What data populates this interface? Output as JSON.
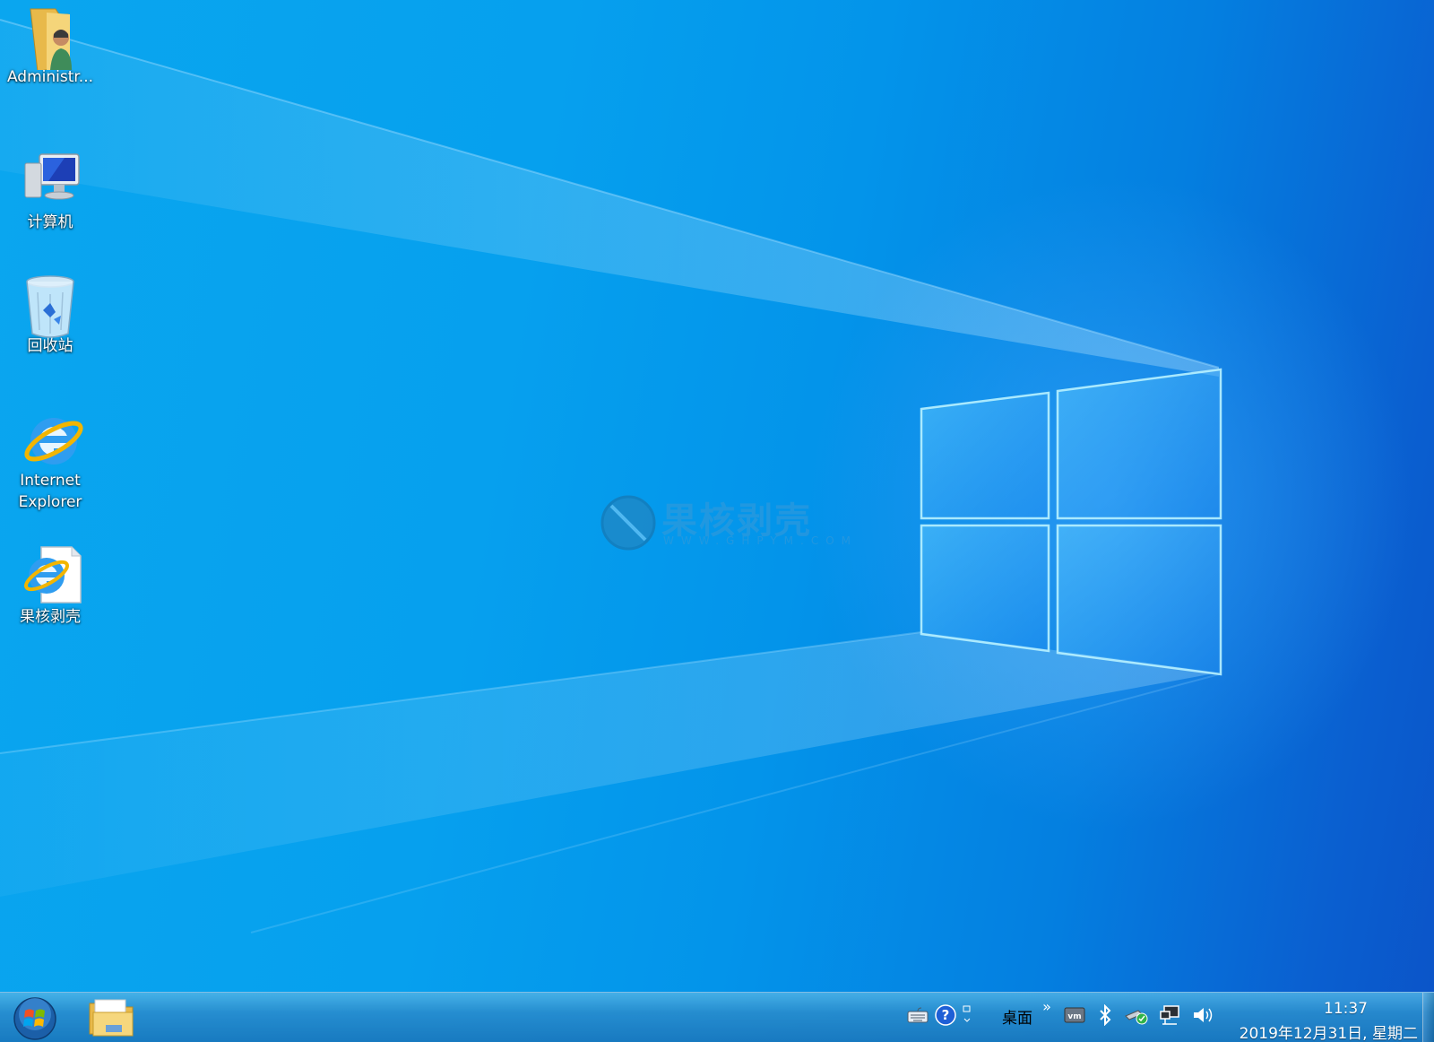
{
  "desktop": {
    "icons": [
      {
        "label": "Administr...",
        "icon": "user-folder-icon"
      },
      {
        "label": "计算机",
        "icon": "computer-icon"
      },
      {
        "label": "回收站",
        "icon": "recycle-bin-icon"
      },
      {
        "label": "Internet\nExplorer",
        "icon": "internet-explorer-icon"
      },
      {
        "label": "果核剥壳",
        "icon": "ie-shortcut-file-icon"
      }
    ]
  },
  "watermark": {
    "title": "果核剥壳",
    "subtitle": "WWW.GHPYM.COM"
  },
  "taskbar": {
    "start_icon": "windows-orb-icon",
    "pinned": [
      {
        "icon": "file-explorer-icon"
      }
    ],
    "tray": {
      "toolbar_label": "桌面",
      "overflow_glyph": "»",
      "time": "11:37",
      "date": "2019年12月31日, 星期二",
      "icons": [
        "keyboard-icon",
        "help-icon",
        "restore-icon",
        "vmware-icon",
        "bluetooth-icon",
        "usb-safe-remove-icon",
        "network-icon",
        "volume-icon"
      ]
    }
  },
  "colors": {
    "bg_light": "#0aa6ef",
    "bg_dark": "#0b54c8",
    "taskbar": "#2a8fcf"
  }
}
